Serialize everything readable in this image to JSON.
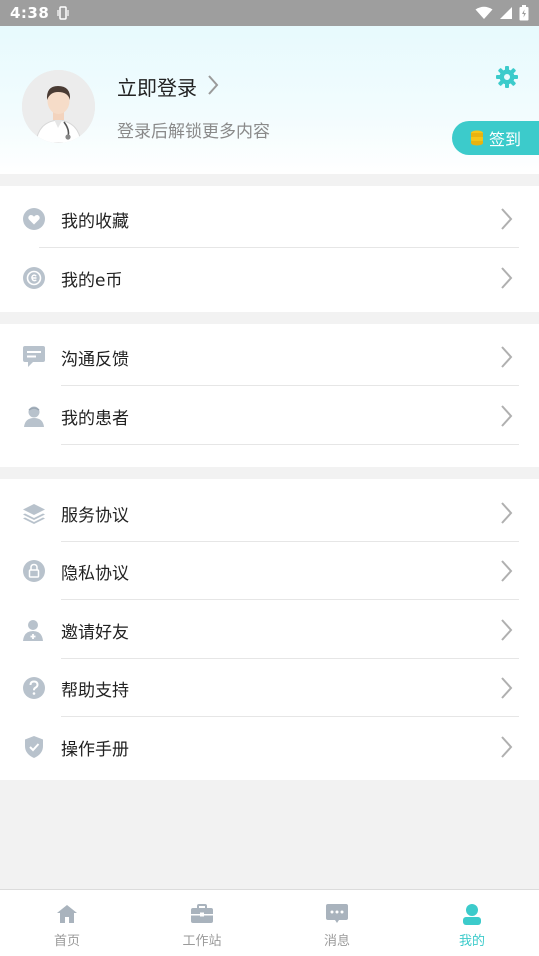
{
  "status_bar": {
    "time": "4:38"
  },
  "profile": {
    "login_title": "立即登录",
    "login_subtitle": "登录后解锁更多内容",
    "signin_label": "签到"
  },
  "groups": [
    {
      "items": [
        {
          "label": "我的收藏",
          "icon": "heart-icon"
        },
        {
          "label": "我的e币",
          "icon": "e-coin-icon"
        }
      ]
    },
    {
      "items": [
        {
          "label": "沟通反馈",
          "icon": "chat-icon"
        },
        {
          "label": "我的患者",
          "icon": "patient-icon"
        }
      ]
    },
    {
      "items": [
        {
          "label": "服务协议",
          "icon": "layers-icon"
        },
        {
          "label": "隐私协议",
          "icon": "lock-icon"
        },
        {
          "label": "邀请好友",
          "icon": "add-user-icon"
        },
        {
          "label": "帮助支持",
          "icon": "help-icon"
        },
        {
          "label": "操作手册",
          "icon": "shield-icon"
        }
      ]
    }
  ],
  "tabs": [
    {
      "label": "首页",
      "icon": "home-icon",
      "active": false
    },
    {
      "label": "工作站",
      "icon": "briefcase-icon",
      "active": false
    },
    {
      "label": "消息",
      "icon": "message-icon",
      "active": false
    },
    {
      "label": "我的",
      "icon": "user-icon",
      "active": true
    }
  ],
  "colors": {
    "accent": "#3ccbcb",
    "icon_gray": "#b8c2cc",
    "status_bar": "#9e9e9e",
    "coin": "#f5c518"
  }
}
